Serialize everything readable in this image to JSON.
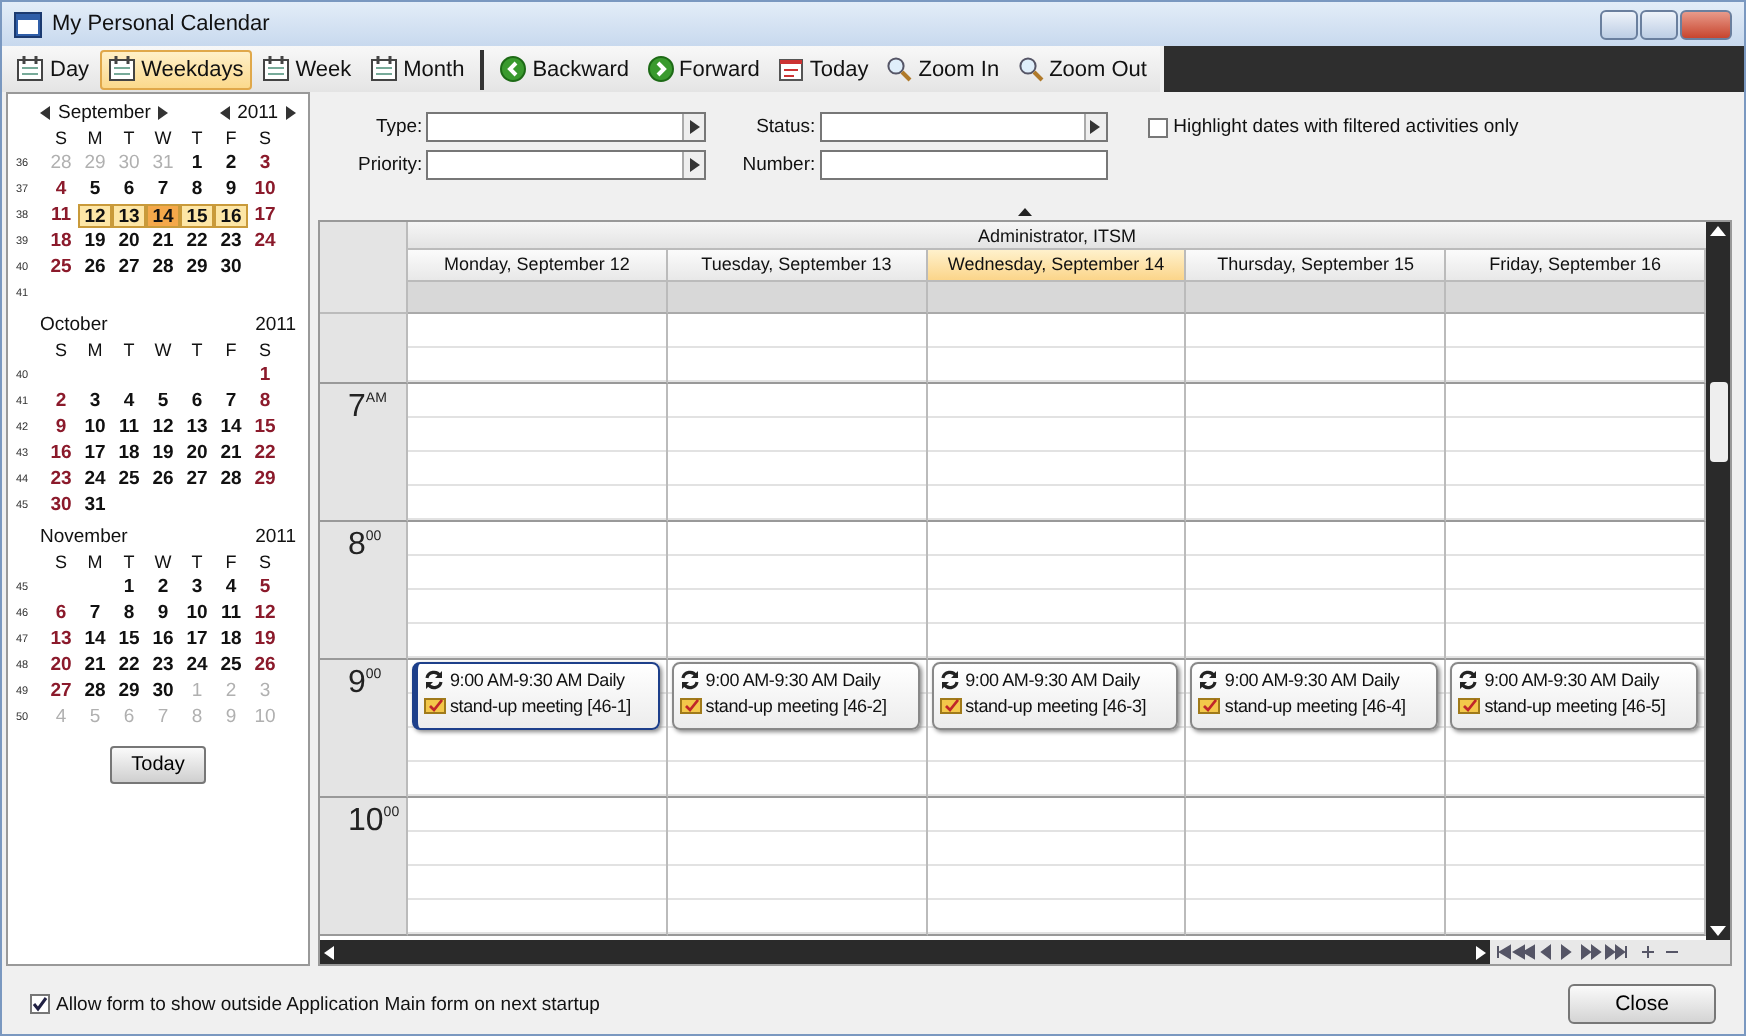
{
  "window": {
    "title": "My Personal Calendar"
  },
  "toolbar": [
    {
      "label": "Day",
      "kind": "view",
      "selected": false
    },
    {
      "label": "Weekdays",
      "kind": "view",
      "selected": true
    },
    {
      "label": "Week",
      "kind": "view",
      "selected": false
    },
    {
      "label": "Month",
      "kind": "view",
      "selected": false
    },
    {
      "label": "Backward",
      "kind": "back",
      "selected": false
    },
    {
      "label": "Forward",
      "kind": "forward",
      "selected": false
    },
    {
      "label": "Today",
      "kind": "today",
      "selected": false
    },
    {
      "label": "Zoom In",
      "kind": "zoom_in",
      "selected": false
    },
    {
      "label": "Zoom Out",
      "kind": "zoom_out",
      "selected": false
    }
  ],
  "mini_calendars": [
    {
      "month": "September",
      "year": "2011",
      "nav": true,
      "weekdays": [
        "S",
        "M",
        "T",
        "W",
        "T",
        "F",
        "S"
      ],
      "weeks": [
        {
          "num": "36",
          "days": [
            {
              "t": "28",
              "other": true,
              "selected": false,
              "today": false
            },
            {
              "t": "29",
              "other": true,
              "selected": false,
              "today": false
            },
            {
              "t": "30",
              "other": true,
              "selected": false,
              "today": false
            },
            {
              "t": "31",
              "other": true,
              "selected": false,
              "today": false
            },
            {
              "t": "1",
              "other": false,
              "selected": false,
              "today": false
            },
            {
              "t": "2",
              "other": false,
              "selected": false,
              "today": false
            },
            {
              "t": "3",
              "other": false,
              "selected": false,
              "today": false
            }
          ]
        },
        {
          "num": "37",
          "days": [
            {
              "t": "4",
              "other": false,
              "selected": false,
              "today": false
            },
            {
              "t": "5",
              "other": false,
              "selected": false,
              "today": false
            },
            {
              "t": "6",
              "other": false,
              "selected": false,
              "today": false
            },
            {
              "t": "7",
              "other": false,
              "selected": false,
              "today": false
            },
            {
              "t": "8",
              "other": false,
              "selected": false,
              "today": false
            },
            {
              "t": "9",
              "other": false,
              "selected": false,
              "today": false
            },
            {
              "t": "10",
              "other": false,
              "selected": false,
              "today": false
            }
          ]
        },
        {
          "num": "38",
          "days": [
            {
              "t": "11",
              "other": false,
              "selected": false,
              "today": false
            },
            {
              "t": "12",
              "other": false,
              "selected": true,
              "today": false
            },
            {
              "t": "13",
              "other": false,
              "selected": true,
              "today": false
            },
            {
              "t": "14",
              "other": false,
              "selected": true,
              "today": true
            },
            {
              "t": "15",
              "other": false,
              "selected": true,
              "today": false
            },
            {
              "t": "16",
              "other": false,
              "selected": true,
              "today": false
            },
            {
              "t": "17",
              "other": false,
              "selected": false,
              "today": false
            }
          ]
        },
        {
          "num": "39",
          "days": [
            {
              "t": "18",
              "other": false,
              "selected": false,
              "today": false
            },
            {
              "t": "19",
              "other": false,
              "selected": false,
              "today": false
            },
            {
              "t": "20",
              "other": false,
              "selected": false,
              "today": false
            },
            {
              "t": "21",
              "other": false,
              "selected": false,
              "today": false
            },
            {
              "t": "22",
              "other": false,
              "selected": false,
              "today": false
            },
            {
              "t": "23",
              "other": false,
              "selected": false,
              "today": false
            },
            {
              "t": "24",
              "other": false,
              "selected": false,
              "today": false
            }
          ]
        },
        {
          "num": "40",
          "days": [
            {
              "t": "25",
              "other": false,
              "selected": false,
              "today": false
            },
            {
              "t": "26",
              "other": false,
              "selected": false,
              "today": false
            },
            {
              "t": "27",
              "other": false,
              "selected": false,
              "today": false
            },
            {
              "t": "28",
              "other": false,
              "selected": false,
              "today": false
            },
            {
              "t": "29",
              "other": false,
              "selected": false,
              "today": false
            },
            {
              "t": "30",
              "other": false,
              "selected": false,
              "today": false
            }
          ]
        },
        {
          "num": "41"
        }
      ]
    },
    {
      "month": "October",
      "year": "2011",
      "nav": false,
      "weekdays": [
        "S",
        "M",
        "T",
        "W",
        "T",
        "F",
        "S"
      ],
      "weeks": [
        {
          "num": "40",
          "kind": "start_gap",
          "days": [
            {
              "t": "1",
              "other": false,
              "selected": false,
              "today": false
            }
          ]
        },
        {
          "num": "41",
          "days": [
            {
              "t": "2",
              "other": false,
              "selected": false,
              "today": false
            },
            {
              "t": "3",
              "other": false,
              "selected": false,
              "today": false
            },
            {
              "t": "4",
              "other": false,
              "selected": false,
              "today": false
            },
            {
              "t": "5",
              "other": false,
              "selected": false,
              "today": false
            },
            {
              "t": "6",
              "other": false,
              "selected": false,
              "today": false
            },
            {
              "t": "7",
              "other": false,
              "selected": false,
              "today": false
            },
            {
              "t": "8",
              "other": false,
              "selected": false,
              "today": false
            }
          ]
        },
        {
          "num": "42",
          "days": [
            {
              "t": "9",
              "other": false,
              "selected": false,
              "today": false
            },
            {
              "t": "10",
              "other": false,
              "selected": false,
              "today": false
            },
            {
              "t": "11",
              "other": false,
              "selected": false,
              "today": false
            },
            {
              "t": "12",
              "other": false,
              "selected": false,
              "today": false
            },
            {
              "t": "13",
              "other": false,
              "selected": false,
              "today": false
            },
            {
              "t": "14",
              "other": false,
              "selected": false,
              "today": false
            },
            {
              "t": "15",
              "other": false,
              "selected": false,
              "today": false
            }
          ]
        },
        {
          "num": "43",
          "days": [
            {
              "t": "16",
              "other": false,
              "selected": false,
              "today": false
            },
            {
              "t": "17",
              "other": false,
              "selected": false,
              "today": false
            },
            {
              "t": "18",
              "other": false,
              "selected": false,
              "today": false
            },
            {
              "t": "19",
              "other": false,
              "selected": false,
              "today": false
            },
            {
              "t": "20",
              "other": false,
              "selected": false,
              "today": false
            },
            {
              "t": "21",
              "other": false,
              "selected": false,
              "today": false
            },
            {
              "t": "22",
              "other": false,
              "selected": false,
              "today": false
            }
          ]
        },
        {
          "num": "44",
          "days": [
            {
              "t": "23",
              "other": false,
              "selected": false,
              "today": false
            },
            {
              "t": "24",
              "other": false,
              "selected": false,
              "today": false
            },
            {
              "t": "25",
              "other": false,
              "selected": false,
              "today": false
            },
            {
              "t": "26",
              "other": false,
              "selected": false,
              "today": false
            },
            {
              "t": "27",
              "other": false,
              "selected": false,
              "today": false
            },
            {
              "t": "28",
              "other": false,
              "selected": false,
              "today": false
            },
            {
              "t": "29",
              "other": false,
              "selected": false,
              "today": false
            }
          ]
        },
        {
          "num": "45",
          "days": [
            {
              "t": "30",
              "other": false,
              "selected": false,
              "today": false
            },
            {
              "t": "31",
              "other": false,
              "selected": false,
              "today": false
            }
          ]
        }
      ]
    },
    {
      "month": "November",
      "year": "2011",
      "nav": false,
      "weekdays": [
        "S",
        "M",
        "T",
        "W",
        "T",
        "F",
        "S"
      ],
      "weeks": [
        {
          "num": "45",
          "kind": "start_gap",
          "days": [
            {
              "t": "1",
              "other": false,
              "selected": false,
              "today": false
            },
            {
              "t": "2",
              "other": false,
              "selected": false,
              "today": false
            },
            {
              "t": "3",
              "other": false,
              "selected": false,
              "today": false
            },
            {
              "t": "4",
              "other": false,
              "selected": false,
              "today": false
            },
            {
              "t": "5",
              "other": false,
              "selected": false,
              "today": false
            }
          ]
        },
        {
          "num": "46",
          "days": [
            {
              "t": "6",
              "other": false,
              "selected": false,
              "today": false
            },
            {
              "t": "7",
              "other": false,
              "selected": false,
              "today": false
            },
            {
              "t": "8",
              "other": false,
              "selected": false,
              "today": false
            },
            {
              "t": "9",
              "other": false,
              "selected": false,
              "today": false
            },
            {
              "t": "10",
              "other": false,
              "selected": false,
              "today": false
            },
            {
              "t": "11",
              "other": false,
              "selected": false,
              "today": false
            },
            {
              "t": "12",
              "other": false,
              "selected": false,
              "today": false
            }
          ]
        },
        {
          "num": "47",
          "days": [
            {
              "t": "13",
              "other": false,
              "selected": false,
              "today": false
            },
            {
              "t": "14",
              "other": false,
              "selected": false,
              "today": false
            },
            {
              "t": "15",
              "other": false,
              "selected": false,
              "today": false
            },
            {
              "t": "16",
              "other": false,
              "selected": false,
              "today": false
            },
            {
              "t": "17",
              "other": false,
              "selected": false,
              "today": false
            },
            {
              "t": "18",
              "other": false,
              "selected": false,
              "today": false
            },
            {
              "t": "19",
              "other": false,
              "selected": false,
              "today": false
            }
          ]
        },
        {
          "num": "48",
          "days": [
            {
              "t": "20",
              "other": false,
              "selected": false,
              "today": false
            },
            {
              "t": "21",
              "other": false,
              "selected": false,
              "today": false
            },
            {
              "t": "22",
              "other": false,
              "selected": false,
              "today": false
            },
            {
              "t": "23",
              "other": false,
              "selected": false,
              "today": false
            },
            {
              "t": "24",
              "other": false,
              "selected": false,
              "today": false
            },
            {
              "t": "25",
              "other": false,
              "selected": false,
              "today": false
            },
            {
              "t": "26",
              "other": false,
              "selected": false,
              "today": false
            }
          ]
        },
        {
          "num": "49",
          "days": [
            {
              "t": "27",
              "other": false,
              "selected": false,
              "today": false
            },
            {
              "t": "28",
              "other": false,
              "selected": false,
              "today": false
            },
            {
              "t": "29",
              "other": false,
              "selected": false,
              "today": false
            },
            {
              "t": "30",
              "other": false,
              "selected": false,
              "today": false
            },
            {
              "t": "1",
              "other": true,
              "selected": false,
              "today": false
            },
            {
              "t": "2",
              "other": true,
              "selected": false,
              "today": false
            },
            {
              "t": "3",
              "other": true,
              "selected": false,
              "today": false
            }
          ]
        },
        {
          "num": "50",
          "days": [
            {
              "t": "4",
              "other": true,
              "selected": false,
              "today": false
            },
            {
              "t": "5",
              "other": true,
              "selected": false,
              "today": false
            },
            {
              "t": "6",
              "other": true,
              "selected": false,
              "today": false
            },
            {
              "t": "7",
              "other": true,
              "selected": false,
              "today": false
            },
            {
              "t": "8",
              "other": true,
              "selected": false,
              "today": false
            },
            {
              "t": "9",
              "other": true,
              "selected": false,
              "today": false
            },
            {
              "t": "10",
              "other": true,
              "selected": false,
              "today": false
            }
          ]
        }
      ]
    }
  ],
  "today_button": "Today",
  "filters": {
    "type": {
      "label": "Type:"
    },
    "priority": {
      "label": "Priority:"
    },
    "status": {
      "label": "Status:"
    },
    "number": {
      "label": "Number:"
    },
    "highlight": {
      "label": "Highlight dates with filtered activities only",
      "checked": false
    }
  },
  "schedule": {
    "owner": "Administrator, ITSM",
    "days": [
      {
        "label": "Monday, September 12",
        "selected": false
      },
      {
        "label": "Tuesday, September 13",
        "selected": false
      },
      {
        "label": "Wednesday, September 14",
        "selected": true
      },
      {
        "label": "Thursday, September 15",
        "selected": false
      },
      {
        "label": "Friday, September 16",
        "selected": false
      }
    ],
    "hours": [
      {
        "kind": "partial"
      },
      {
        "kind": "hour",
        "label": "7$^{AM}$"
      },
      {
        "kind": "hour",
        "label": "8$^{00}$"
      },
      {
        "kind": "hour",
        "label": "9$^{00}$",
        "events": [
          {
            "text": "9:00 AM-9:30 AM Daily stand-up meeting [46-1]",
            "selected": true
          },
          {
            "text": "9:00 AM-9:30 AM Daily stand-up meeting [46-2]",
            "selected": false
          },
          {
            "text": "9:00 AM-9:30 AM Daily stand-up meeting [46-3]",
            "selected": false
          },
          {
            "text": "9:00 AM-9:30 AM Daily stand-up meeting [46-4]",
            "selected": false
          },
          {
            "text": "9:00 AM-9:30 AM Daily stand-up meeting [46-5]",
            "selected": false
          }
        ]
      },
      {
        "kind": "hour",
        "label": "10$^{00}$"
      }
    ]
  },
  "footer": {
    "option": {
      "label": "Allow form to show outside Application Main form on next startup",
      "checked": true
    },
    "close": "Close"
  }
}
